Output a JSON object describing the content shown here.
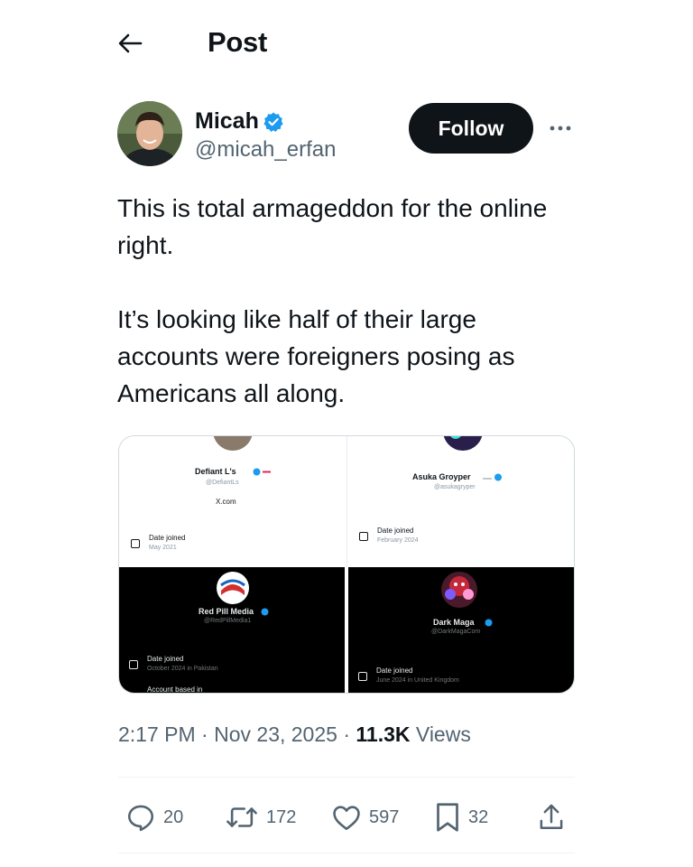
{
  "header": {
    "title": "Post"
  },
  "author": {
    "display_name": "Micah",
    "handle": "@micah_erfan",
    "verified": true,
    "follow_label": "Follow"
  },
  "post": {
    "paragraphs": [
      "This is total armageddon for the online right.",
      "It’s looking like half of their large accounts were foreigners posing as Americans all along."
    ]
  },
  "media": {
    "panels": [
      {
        "name": "Defiant L's",
        "handle": "@DefiantLs",
        "extra": "X.com",
        "label": "Date joined",
        "sub": "May 2021",
        "theme": "light"
      },
      {
        "name": "Asuka Groyper",
        "handle": "@asukagryper",
        "label": "Date joined",
        "sub": "February 2024",
        "theme": "light"
      },
      {
        "name": "Red Pill Media",
        "handle": "@RedPillMedia1",
        "label": "Date joined",
        "sub": "October 2024 in Pakistan",
        "label2": "Account based in",
        "theme": "dark"
      },
      {
        "name": "Dark Maga",
        "handle": "@DarkMagaCom",
        "label": "Date joined",
        "sub": "June 2024 in United Kingdom",
        "theme": "dark"
      }
    ]
  },
  "meta": {
    "time": "2:17 PM",
    "date": "Nov 23, 2025",
    "separator": "·",
    "views_count": "11.3K",
    "views_label": "Views"
  },
  "actions": {
    "replies": "20",
    "reposts": "172",
    "likes": "597",
    "bookmarks": "32"
  },
  "colors": {
    "text": "#0f1419",
    "secondary": "#536471",
    "verified": "#1d9bf0",
    "follow_bg": "#0f1419",
    "divider": "#eff3f4"
  },
  "icons": {
    "back": "arrow-left-icon",
    "verified": "verified-badge-icon",
    "more": "ellipsis-icon",
    "reply": "speech-bubble-icon",
    "repost": "repost-arrows-icon",
    "like": "heart-icon",
    "bookmark": "bookmark-icon",
    "share": "share-upload-icon"
  }
}
